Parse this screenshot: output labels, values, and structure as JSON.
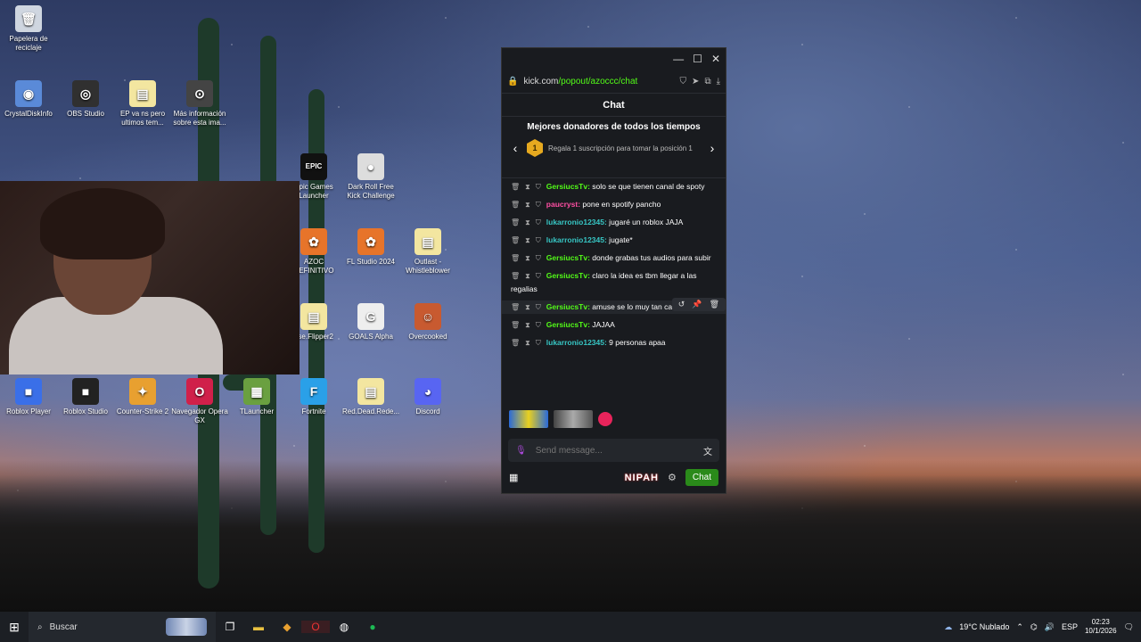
{
  "desktop": {
    "icons": [
      {
        "label": "Papelera de reciclaje",
        "glyph": "🗑",
        "color": "#cfd6e0"
      },
      {
        "label": "CrystalDiskInfo",
        "glyph": "◉",
        "color": "#5a8ad8"
      },
      {
        "label": "OBS Studio",
        "glyph": "◎",
        "color": "#303030"
      },
      {
        "label": "EP va ns pero ultimos tem...",
        "glyph": "▤",
        "color": "#f3e6a0"
      },
      {
        "label": "Más información sobre esta ima...",
        "glyph": "⊙",
        "color": "#444"
      },
      {
        "label": "Epic Games Launcher",
        "glyph": "EPIC",
        "color": "#111"
      },
      {
        "label": "Dark Roll Free Kick Challenge",
        "glyph": "●",
        "color": "#ddd"
      },
      {
        "label": "AZOC DEFINITIVO",
        "glyph": "✿",
        "color": "#e7742a"
      },
      {
        "label": "FL Studio 2024",
        "glyph": "✿",
        "color": "#e7742a"
      },
      {
        "label": "Outlast - Whistleblower",
        "glyph": "▤",
        "color": "#f3e6a0"
      },
      {
        "label": "use.Flipper2",
        "glyph": "▤",
        "color": "#f3e6a0"
      },
      {
        "label": "GOALS Alpha",
        "glyph": "G",
        "color": "#eee"
      },
      {
        "label": "Overcooked",
        "glyph": "☺",
        "color": "#c85a30"
      },
      {
        "label": "Roblox Player",
        "glyph": "■",
        "color": "#3a6fe8"
      },
      {
        "label": "Roblox Studio",
        "glyph": "■",
        "color": "#222"
      },
      {
        "label": "Counter-Strike 2",
        "glyph": "✦",
        "color": "#e8a030"
      },
      {
        "label": "Navegador Opera GX",
        "glyph": "O",
        "color": "#d0204a"
      },
      {
        "label": "TLauncher",
        "glyph": "▦",
        "color": "#6aa040"
      },
      {
        "label": "Fortnite",
        "glyph": "F",
        "color": "#2aa0e8"
      },
      {
        "label": "Red.Dead.Rede...",
        "glyph": "▤",
        "color": "#f3e6a0"
      },
      {
        "label": "Discord",
        "glyph": "◕",
        "color": "#5865f2"
      }
    ]
  },
  "window": {
    "controls": {
      "minimize": "—",
      "maximize": "☐",
      "close": "✕"
    },
    "url_host": "kick.com",
    "url_path": "/popout/azoccc/chat",
    "chat_title": "Chat",
    "donors": {
      "title": "Mejores donadores de todos los tiempos",
      "badge": "1",
      "text": "Regala 1 suscripción para tomar la posición 1",
      "prev": "‹",
      "next": "›"
    },
    "messages": [
      {
        "user": "GersiucsTv",
        "color": "#53fc18",
        "text": " solo se que tienen canal de spoty"
      },
      {
        "user": "paucryst",
        "color": "#ff4fa3",
        "text": " pone en spotify pancho"
      },
      {
        "user": "lukarronio12345",
        "color": "#37c6c4",
        "text": " jugaré un roblox JAJA"
      },
      {
        "user": "lukarronio12345",
        "color": "#37c6c4",
        "text": " jugate*"
      },
      {
        "user": "GersiucsTv",
        "color": "#53fc18",
        "text": " donde grabas tus audios para subir"
      },
      {
        "user": "GersiucsTv",
        "color": "#53fc18",
        "text": " claro la idea es tbm llegar a las regalias"
      },
      {
        "user": "GersiucsTv",
        "color": "#53fc18",
        "text": " amuse se lo muy tan cara",
        "highlight": true
      },
      {
        "user": "GersiucsTv",
        "color": "#53fc18",
        "text": " JAJAA"
      },
      {
        "user": "lukarronio12345",
        "color": "#37c6c4",
        "text": " 9 personas apaa"
      }
    ],
    "input_placeholder": "Send message...",
    "nipah": "NIPAH",
    "chat_button": "Chat"
  },
  "taskbar": {
    "search": "Buscar",
    "weather": "19°C  Nublado",
    "lang": "ESP",
    "time": "02:23",
    "date": "10/1/2026"
  }
}
